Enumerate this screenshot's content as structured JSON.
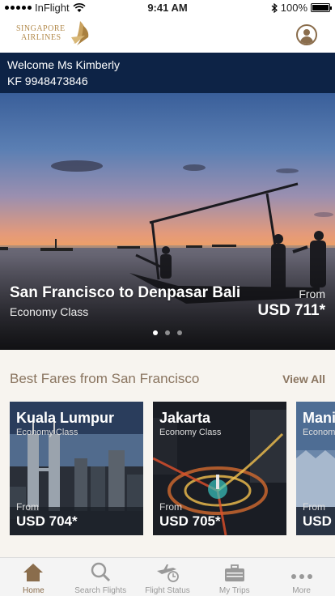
{
  "status_bar": {
    "carrier": "InFlight",
    "time": "9:41 AM",
    "battery": "100%",
    "battery_level": 1.0
  },
  "header": {
    "logo_line1": "SINGAPORE",
    "logo_line2": "AIRLINES"
  },
  "welcome": {
    "greeting": "Welcome Ms Kimberly",
    "membership": "KF 9948473846"
  },
  "hero": {
    "route": "San Francisco to Denpasar Bali",
    "cabin": "Economy Class",
    "from_label": "From",
    "price": "USD 711*",
    "active_slide": 0,
    "slide_count": 3
  },
  "best_fares": {
    "title": "Best Fares from San Francisco",
    "view_all": "View All",
    "cards": [
      {
        "city": "Kuala Lumpur",
        "cabin": "Economy Class",
        "from_label": "From",
        "price": "USD 704*"
      },
      {
        "city": "Jakarta",
        "cabin": "Economy Class",
        "from_label": "From",
        "price": "USD 705*"
      },
      {
        "city": "Mani",
        "cabin": "Econom",
        "from_label": "From",
        "price": "USD"
      }
    ]
  },
  "tabs": [
    {
      "label": "Home",
      "icon": "home-icon",
      "active": true
    },
    {
      "label": "Search Flights",
      "icon": "search-icon",
      "active": false
    },
    {
      "label": "Flight Status",
      "icon": "flight-status-icon",
      "active": false
    },
    {
      "label": "My Trips",
      "icon": "suitcase-icon",
      "active": false
    },
    {
      "label": "More",
      "icon": "more-icon",
      "active": false
    }
  ],
  "colors": {
    "navy": "#0d2346",
    "gold": "#b38b4d",
    "brown_text": "#8a7560"
  }
}
